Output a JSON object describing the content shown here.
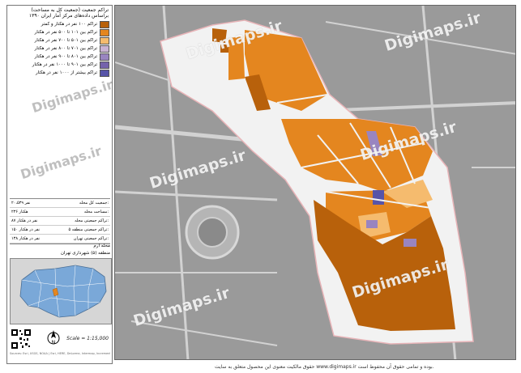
{
  "title": {
    "line1": "تراکم جمعیت (جمعیت کل به مساحت)",
    "line2": "براساس داده‌های مرکز آمار ایران ۱۳۹۰"
  },
  "legend": [
    {
      "label": "تراکم ۱۰۰ نفر در هکتار و کمتر",
      "color": "#b8610b"
    },
    {
      "label": "تراکم بین ۱۰۱ تا ۵۰۰ نفر در هکتار",
      "color": "#e4861f"
    },
    {
      "label": "تراکم بین ۵۰۱ تا ۷۰۰ نفر در هکتار",
      "color": "#f5bb6e"
    },
    {
      "label": "تراکم بین ۷۰۱ تا ۸۰۰ نفر در هکتار",
      "color": "#c9b3d4"
    },
    {
      "label": "تراکم بین ۸۰۱ تا ۹۰۰ نفر در هکتار",
      "color": "#9985c0"
    },
    {
      "label": "تراکم بین ۹۰۱ تا ۱۰۰۰ نفر در هکتار",
      "color": "#7463ab"
    },
    {
      "label": "تراکم بیشتر از ۱۰۰۰ نفر در هکتار",
      "color": "#5754a8"
    }
  ],
  "stats": [
    {
      "label": "جمعیت کل محله:",
      "value": "۲۰،۵۳۹ نفر"
    },
    {
      "label": "مساحت محله:",
      "value": "۲۳۶ هکتار"
    },
    {
      "label": "تراکم جمعیتی محله:",
      "value": "۸۷ نفر در هکتار"
    },
    {
      "label": "تراکم جمعیتی منطقه ۵:",
      "value": "۱۵۰ نفر در هکتار"
    },
    {
      "label": "تراکم جمعیتی تهران:",
      "value": "۱۳۸ نفر در هکتار"
    }
  ],
  "area": {
    "neighborhood": "محله ارم",
    "district": "منطقه (۵) شهرداری تهران"
  },
  "scale": "Scale = 1:15,000",
  "north_label": "N",
  "footnote": "Sources: Esri, USGS, NOAA | Esri, HERE, DeLorme, Intermap, Increment P Corp., GEBCO, USGS, FAO, NPS, NRCAN, GeoBase",
  "watermark": "Digimaps.ir",
  "disclaimer": "حقوق مالکیت معنوی این محصول متعلق به سایت www.digimaps.ir بوده و تمامی حقوق آن محفوظ است.",
  "colors": {
    "basemap": "#9a9a9a",
    "road": "#d2d2d2",
    "boundary": "#e8b4b8",
    "nodata": "#f2f2f2",
    "class1": "#b8610b",
    "class2": "#e4861f",
    "class3": "#f5bb6e",
    "class5": "#9985c0",
    "class7": "#5754a8"
  },
  "icons": [
    "north-arrow-icon",
    "qr-code-icon"
  ]
}
